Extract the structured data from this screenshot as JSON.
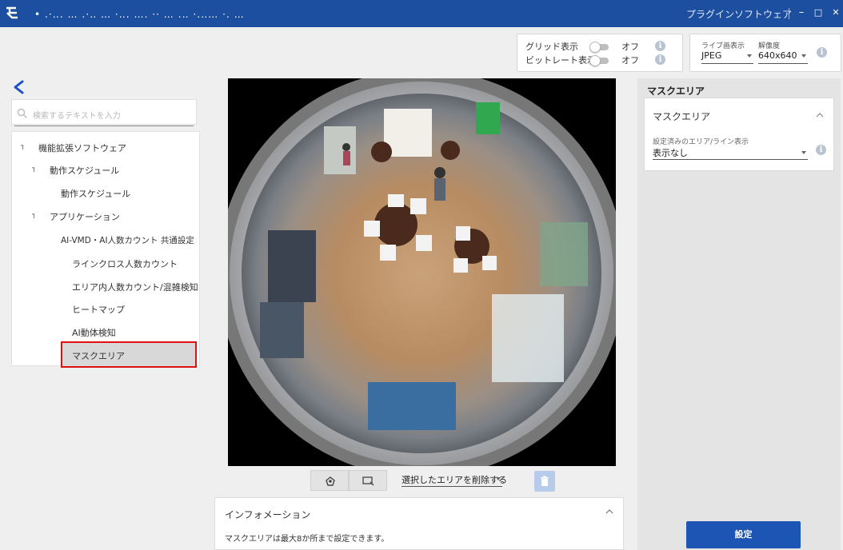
{
  "titlebar": {
    "title": "　• ․·‥․ … ․·‥ … ·‥․ …․ ·· … ․‥ ·․‥… ·․ …",
    "app_label": "プラグインソフトウェア",
    "minimize_label": "–",
    "maximize_label": "□",
    "close_label": "✕"
  },
  "view_controls": {
    "grid_label": "グリッド表示",
    "grid_value": "オフ",
    "bitrate_label": "ビットレート表示",
    "bitrate_value": "オフ"
  },
  "live_controls": {
    "live_label": "ライブ画表示",
    "live_value": "JPEG",
    "resolution_label": "解像度",
    "resolution_value": "640x640"
  },
  "search": {
    "placeholder": "検索するテキストを入力"
  },
  "tree": {
    "items": [
      {
        "label": "機能拡張ソフトウェア",
        "toggle": "┐"
      },
      {
        "label": "動作スケジュール",
        "toggle": "┐"
      },
      {
        "label": "動作スケジュール"
      },
      {
        "label": "アプリケーション",
        "toggle": "┐"
      },
      {
        "label": "AI-VMD・AI人数カウント 共通設定"
      },
      {
        "label": "ラインクロス人数カウント"
      },
      {
        "label": "エリア内人数カウント/混雑検知"
      },
      {
        "label": "ヒートマップ"
      },
      {
        "label": "AI動体検知"
      },
      {
        "label": "マスクエリア"
      }
    ]
  },
  "toolbar": {
    "delete_select_value": "選択したエリアを削除する"
  },
  "info_panel": {
    "title": "インフォメーション",
    "message": "マスクエリアは最大8か所まで設定できます。"
  },
  "right_panel": {
    "header": "マスクエリア",
    "card_title": "マスクエリア",
    "select_label": "設定済みのエリア/ライン表示",
    "select_value": "表示なし",
    "submit_label": "設定"
  },
  "colors": {
    "titlebar": "#1d4fa1",
    "primary_button": "#1d55b4",
    "selection_outline": "#e01010"
  }
}
